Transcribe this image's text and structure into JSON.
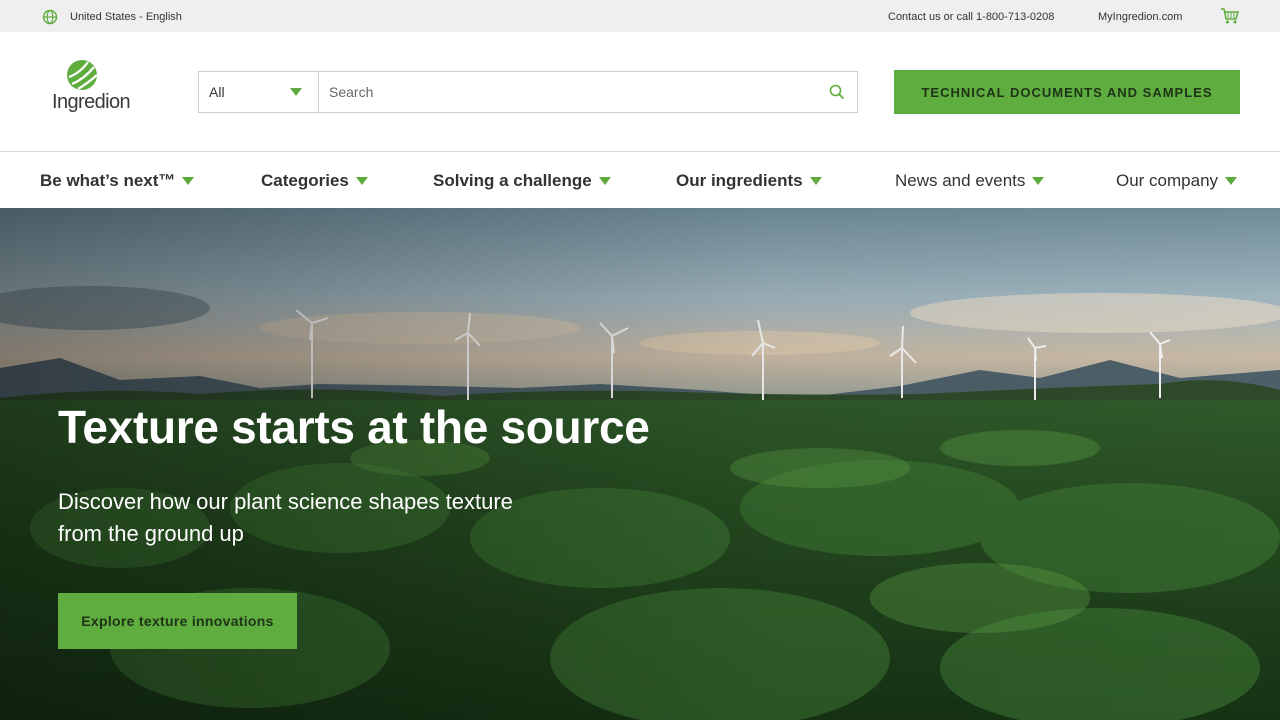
{
  "utility": {
    "locale": "United States - English",
    "contact": "Contact us or call 1-800-713-0208",
    "my_ingredion": "MyIngredion.com"
  },
  "header": {
    "logo_text": "Ingredion",
    "search": {
      "category_selected": "All",
      "placeholder": "Search"
    },
    "cta": "TECHNICAL DOCUMENTS AND SAMPLES"
  },
  "nav": {
    "items": [
      {
        "label": "Be what’s next™"
      },
      {
        "label": "Categories"
      },
      {
        "label": "Solving a challenge"
      },
      {
        "label": "Our ingredients"
      },
      {
        "label": "News and events"
      },
      {
        "label": "Our company"
      }
    ]
  },
  "hero": {
    "title": "Texture starts at the source",
    "subtitle": "Discover how our plant science shapes texture from the ground up",
    "cta": "Explore texture innovations"
  },
  "colors": {
    "accent_green": "#5fad3e",
    "utility_bg": "#efefef",
    "text_dark": "#333333"
  },
  "icons": {
    "locale": "globe-icon",
    "cart": "cart-icon",
    "search": "search-icon",
    "dropdown": "caret-down-icon"
  }
}
